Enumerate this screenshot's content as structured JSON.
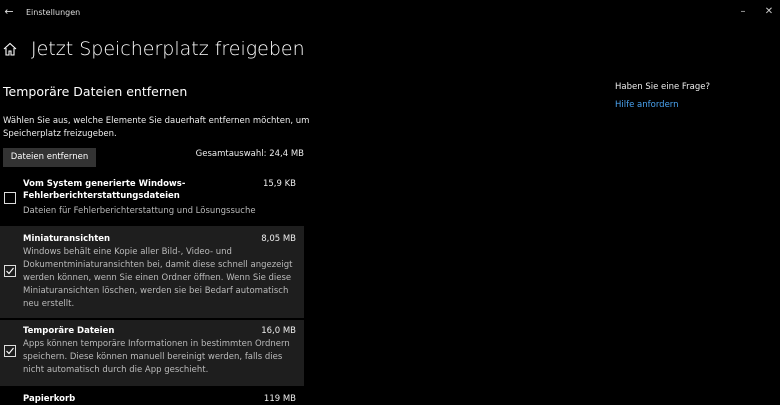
{
  "window": {
    "title": "Einstellungen",
    "back_glyph": "←",
    "minimize_glyph": "–",
    "maximize_glyph": "☐",
    "close_glyph": "✕"
  },
  "page": {
    "title": "Jetzt Speicherplatz freigeben",
    "icon": "home-icon"
  },
  "section": {
    "heading": "Temporäre Dateien entfernen",
    "description": "Wählen Sie aus, welche Elemente Sie dauerhaft entfernen möchten, um Speicherplatz freizugeben.",
    "remove_button": "Dateien entfernen",
    "total_selection": "Gesamtauswahl: 24,4 MB"
  },
  "items": [
    {
      "title": "Vom System generierte Windows-Fehlerberichterstattungsdateien",
      "size": "15,9 KB",
      "description": "Dateien für Fehlerberichterstattung und Lösungssuche",
      "checked": false
    },
    {
      "title": "Miniaturansichten",
      "size": "8,05 MB",
      "description": "Windows behält eine Kopie aller Bild-, Video- und Dokumentminiaturansichten bei, damit diese schnell angezeigt werden können, wenn Sie einen Ordner öffnen. Wenn Sie diese Miniaturansichten löschen, werden sie bei Bedarf automatisch neu erstellt.",
      "checked": true
    },
    {
      "title": "Temporäre Dateien",
      "size": "16,0 MB",
      "description": "Apps können temporäre Informationen in bestimmten Ordnern speichern. Diese können manuell bereinigt werden, falls dies nicht automatisch durch die App geschieht.",
      "checked": true
    },
    {
      "title": "Papierkorb",
      "size": "119 MB",
      "description": "",
      "checked": false
    }
  ],
  "help": {
    "question": "Haben Sie eine Frage?",
    "link": "Hilfe anfordern"
  },
  "colors": {
    "background": "#000000",
    "selected_row": "#1e1e1e",
    "button": "#333333",
    "link": "#4aa3f0"
  }
}
